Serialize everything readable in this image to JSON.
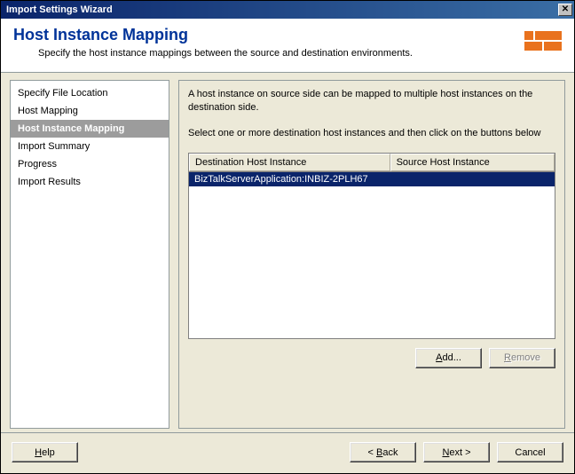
{
  "window": {
    "title": "Import Settings Wizard"
  },
  "header": {
    "title": "Host Instance Mapping",
    "subtitle": "Specify the host instance mappings between the source and destination environments."
  },
  "sidebar": {
    "items": [
      {
        "label": "Specify File Location",
        "active": false
      },
      {
        "label": "Host Mapping",
        "active": false
      },
      {
        "label": "Host Instance Mapping",
        "active": true
      },
      {
        "label": "Import Summary",
        "active": false
      },
      {
        "label": "Progress",
        "active": false
      },
      {
        "label": "Import Results",
        "active": false
      }
    ]
  },
  "main": {
    "intro": "A host instance on source side can be mapped to multiple host instances on the destination side.",
    "instruction": "Select one or more destination host instances and then click on the buttons below",
    "columns": {
      "dest": "Destination Host Instance",
      "src": "Source Host Instance"
    },
    "rows": [
      {
        "dest": "BizTalkServerApplication:INBIZ-2PLH67",
        "src": ""
      }
    ],
    "add_label": "Add...",
    "remove_label": "Remove"
  },
  "footer": {
    "help": "Help",
    "back": "Back",
    "next": "Next",
    "cancel": "Cancel"
  }
}
